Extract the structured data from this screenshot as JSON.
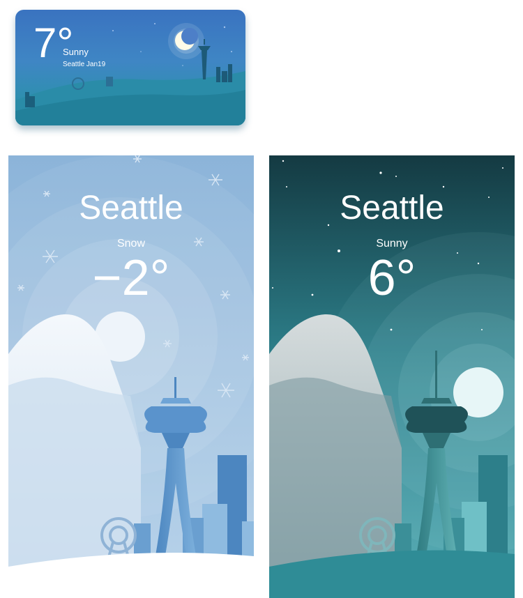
{
  "widget": {
    "temperature": "7°",
    "condition": "Sunny",
    "location_date": "Seattle Jan19"
  },
  "snow_card": {
    "city": "Seattle",
    "condition": "Snow",
    "temperature": "−2°"
  },
  "sunny_card": {
    "city": "Seattle",
    "condition": "Sunny",
    "temperature": "6°"
  },
  "colors": {
    "widget_sky": "#3a73c0",
    "snow_sky": "#a9c8e3",
    "night_sky": "#1d4a52",
    "teal_ground": "#1f7f93"
  }
}
